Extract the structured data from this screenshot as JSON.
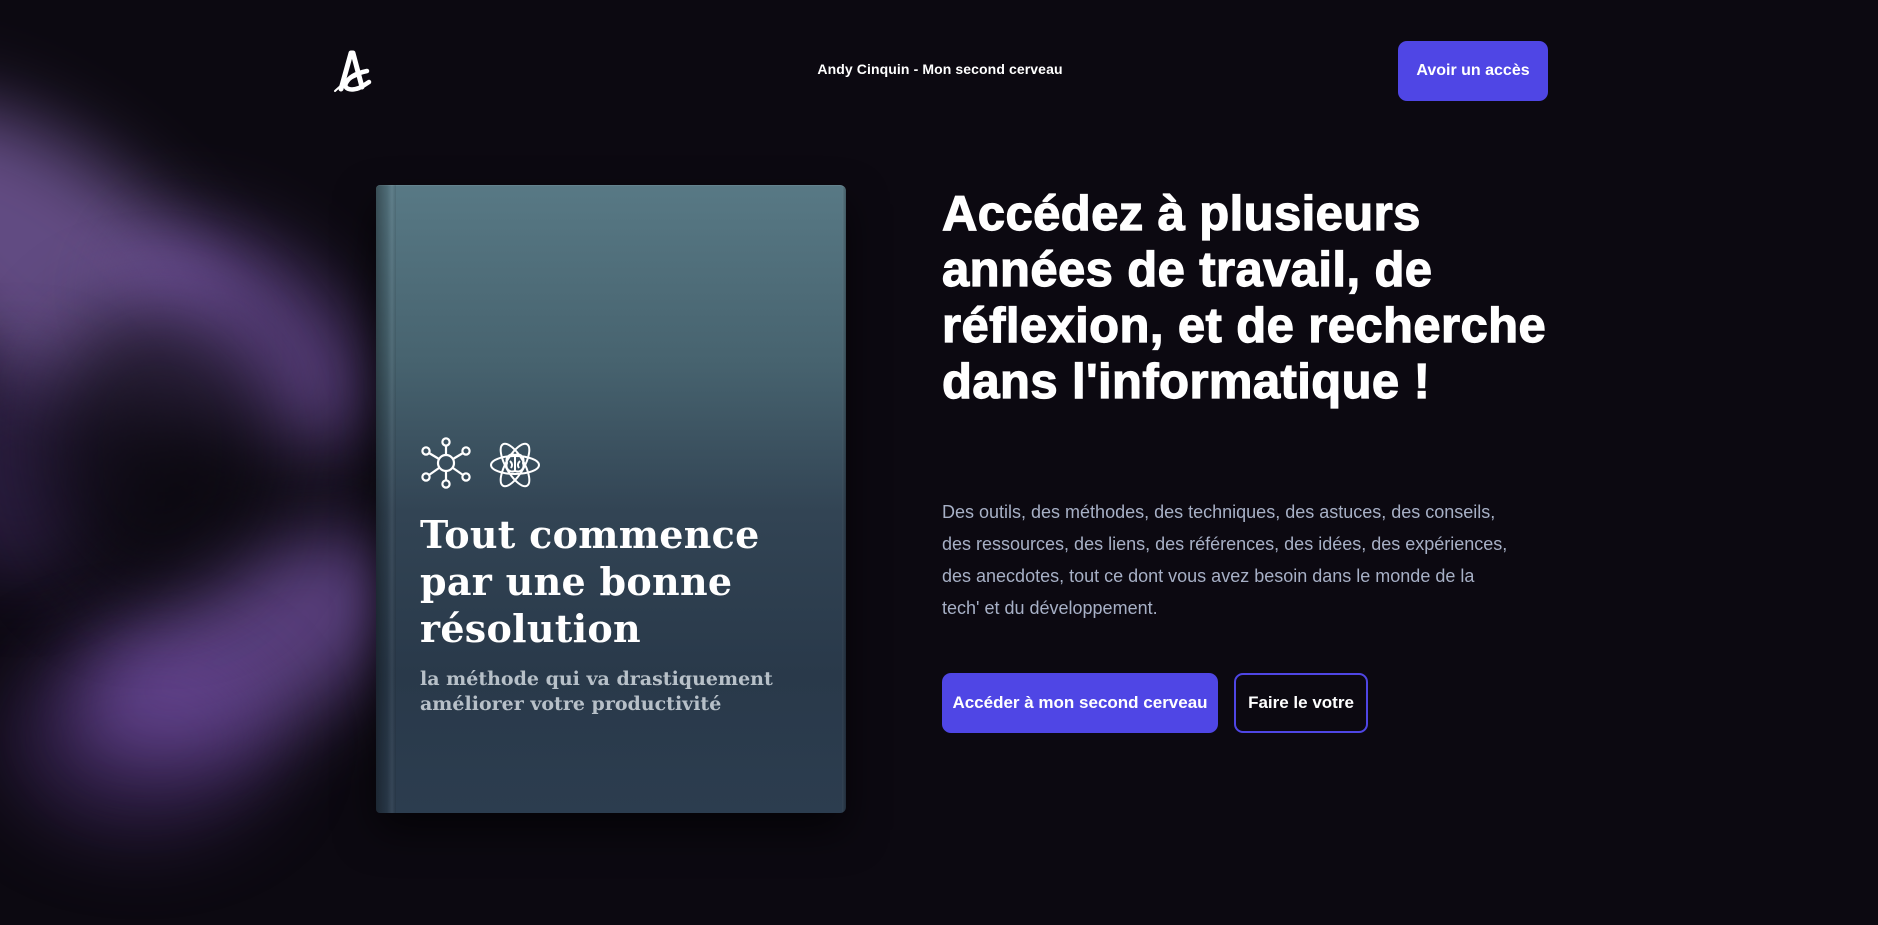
{
  "header": {
    "site_title": "Andy Cinquin - Mon second cerveau",
    "cta_label": "Avoir un accès",
    "logo_icon": "ac-monogram-logo"
  },
  "book": {
    "icons": [
      "network-nodes-icon",
      "brain-atom-icon"
    ],
    "title": "Tout commence par une bonne résolution",
    "subtitle": "la méthode qui va drastiquement améliorer votre productivité"
  },
  "hero": {
    "heading": "Accédez à plusieurs années de travail, de réflexion, et de recherche dans l'informatique !",
    "description": "Des outils, des méthodes, des techniques, des astuces, des conseils, des ressources, des liens, des références, des idées, des expériences, des anecdotes, tout ce dont vous avez besoin dans le monde de la tech' et du développement.",
    "primary_cta": "Accéder à mon second cerveau",
    "secondary_cta": "Faire le votre"
  },
  "colors": {
    "background": "#0c0911",
    "accent": "#4f46e5",
    "glow": "#a882de",
    "text_muted": "#a7b0c6"
  }
}
